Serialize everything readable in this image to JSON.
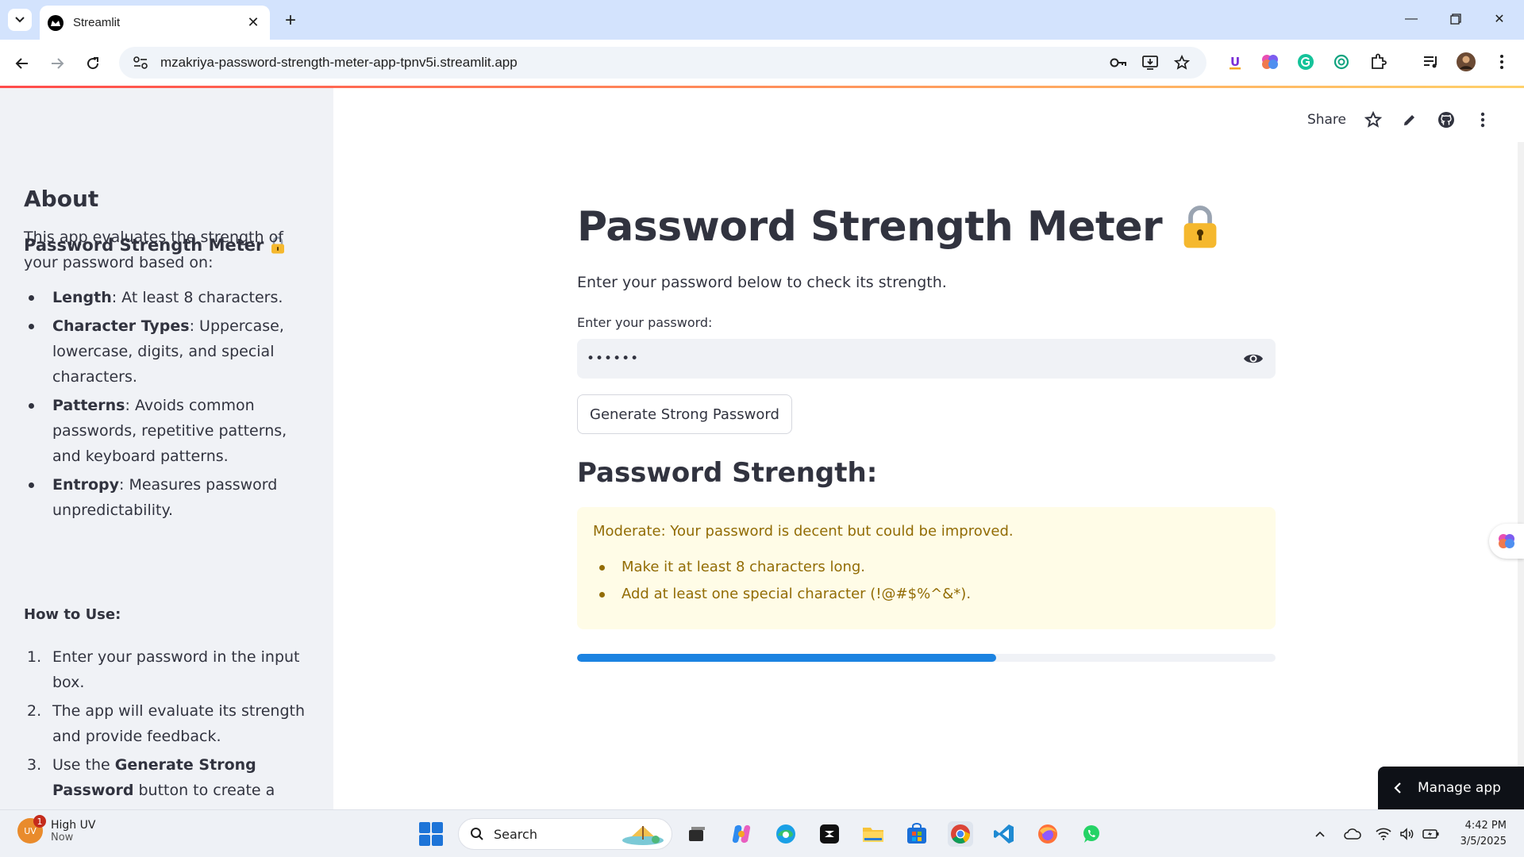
{
  "browser": {
    "tab_title": "Streamlit",
    "url": "mzakriya-password-strength-meter-app-tpnv5i.streamlit.app"
  },
  "header": {
    "share_label": "Share"
  },
  "sidebar": {
    "heading": "About",
    "subheading": "Password Strength Meter",
    "intro": "This app evaluates the strength of your password based on:",
    "criteria": [
      {
        "term": "Length",
        "desc": ": At least 8 characters."
      },
      {
        "term": "Character Types",
        "desc": ": Uppercase, lowercase, digits, and special characters."
      },
      {
        "term": "Patterns",
        "desc": ": Avoids common passwords, repetitive patterns, and keyboard patterns."
      },
      {
        "term": "Entropy",
        "desc": ": Measures password unpredictability."
      }
    ],
    "howto_heading": "How to Use:",
    "steps": [
      {
        "num": "1.",
        "pre": "Enter your password in the input box.",
        "bold": "",
        "post": ""
      },
      {
        "num": "2.",
        "pre": "The app will evaluate its strength and provide feedback.",
        "bold": "",
        "post": ""
      },
      {
        "num": "3.",
        "pre": "Use the ",
        "bold": "Generate Strong Password",
        "post": " button to create a secure password."
      }
    ]
  },
  "main": {
    "title": "Password Strength Meter",
    "intro": "Enter your password below to check its strength.",
    "input_label": "Enter your password:",
    "input_value": "••••••",
    "generate_button": "Generate Strong Password",
    "strength_heading": "Password Strength:",
    "alert": {
      "message": "Moderate: Your password is decent but could be improved.",
      "suggestions": [
        "Make it at least 8 characters long.",
        "Add at least one special character (!@#$%^&*)."
      ]
    },
    "progress_fraction": 0.6
  },
  "manage_app_label": "Manage app",
  "taskbar": {
    "weather_title": "High UV",
    "weather_sub": "Now",
    "uv_badge": "UV",
    "uv_count": "1",
    "search_label": "Search",
    "time": "4:42 PM",
    "date": "3/5/2025"
  },
  "colors": {
    "sidebar_bg": "#f0f2f6",
    "alert_bg": "#fffce7",
    "alert_text": "#926c05",
    "progress_fill": "#1c83e1",
    "manage_bg": "#0e1117"
  }
}
